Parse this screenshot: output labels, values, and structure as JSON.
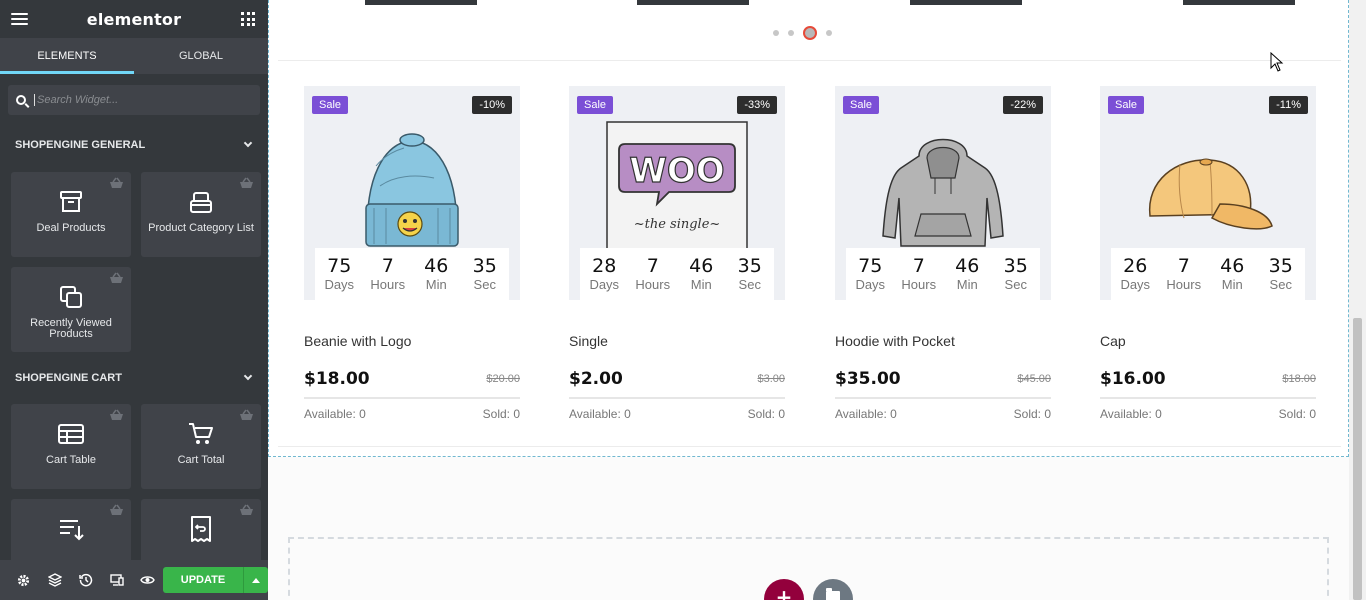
{
  "sidebar": {
    "logo": "elementor",
    "tabs": [
      {
        "label": "ELEMENTS",
        "active": true
      },
      {
        "label": "GLOBAL",
        "active": false
      }
    ],
    "search": {
      "placeholder": "Search Widget...",
      "value": ""
    },
    "sections": [
      {
        "title": "SHOPENGINE GENERAL"
      },
      {
        "title": "SHOPENGINE CART"
      }
    ],
    "general_widgets": [
      {
        "label": "Deal Products",
        "icon": "archive-box-icon"
      },
      {
        "label": "Product Category List",
        "icon": "stacked-box-icon"
      },
      {
        "label": "Recently Viewed Products",
        "icon": "copy-squares-icon"
      }
    ],
    "cart_widgets": [
      {
        "label": "Cart Table",
        "icon": "table-icon"
      },
      {
        "label": "Cart Total",
        "icon": "cart-icon"
      },
      {
        "label": "",
        "icon": "sort-list-icon"
      },
      {
        "label": "",
        "icon": "return-receipt-icon"
      }
    ],
    "footer": {
      "update_label": "UPDATE"
    }
  },
  "canvas": {
    "products": [
      {
        "sale": "Sale",
        "discount": "-10%",
        "title": "Beanie with Logo",
        "price": "$18.00",
        "old_price": "$20.00",
        "available": "Available: 0",
        "sold": "Sold: 0",
        "countdown": {
          "days": "75",
          "hours": "7",
          "min": "46",
          "sec": "35"
        },
        "image": "beanie-image"
      },
      {
        "sale": "Sale",
        "discount": "-33%",
        "title": "Single",
        "price": "$2.00",
        "old_price": "$3.00",
        "available": "Available: 0",
        "sold": "Sold: 0",
        "countdown": {
          "days": "28",
          "hours": "7",
          "min": "46",
          "sec": "35"
        },
        "image": "woo-single-image"
      },
      {
        "sale": "Sale",
        "discount": "-22%",
        "title": "Hoodie with Pocket",
        "price": "$35.00",
        "old_price": "$45.00",
        "available": "Available: 0",
        "sold": "Sold: 0",
        "countdown": {
          "days": "75",
          "hours": "7",
          "min": "46",
          "sec": "35"
        },
        "image": "hoodie-image"
      },
      {
        "sale": "Sale",
        "discount": "-11%",
        "title": "Cap",
        "price": "$16.00",
        "old_price": "$18.00",
        "available": "Available: 0",
        "sold": "Sold: 0",
        "countdown": {
          "days": "26",
          "hours": "7",
          "min": "46",
          "sec": "35"
        },
        "image": "cap-image"
      }
    ],
    "countdown_labels": {
      "days": "Days",
      "hours": "Hours",
      "min": "Min",
      "sec": "Sec"
    },
    "add_section_symbol": "+",
    "colors": {
      "sale": "#7b4fd6",
      "update": "#39b54a",
      "add": "#93003c",
      "dot_active": "#e64a39"
    }
  }
}
